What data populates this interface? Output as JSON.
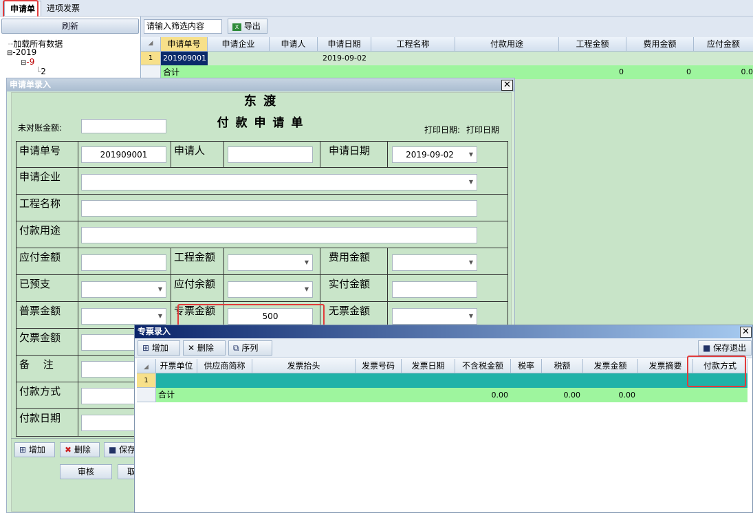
{
  "tabs": {
    "t1": "申请单",
    "t2": "进项发票"
  },
  "left": {
    "refresh": "刷新",
    "tree_root": "加载所有数据",
    "year": "2019",
    "month": "9",
    "day": "2"
  },
  "toolbar": {
    "filter_placeholder": "请输入筛选内容",
    "export": "导出"
  },
  "main_grid": {
    "headers": [
      "申请单号",
      "申请企业",
      "申请人",
      "申请日期",
      "工程名称",
      "付款用途",
      "工程金额",
      "费用金额",
      "应付金额"
    ],
    "row_num": "1",
    "row": {
      "id": "201909001",
      "date": "2019-09-02"
    },
    "total_label": "合计",
    "totals": {
      "gc": "0",
      "fy": "0",
      "yf": "0.0"
    }
  },
  "form": {
    "title": "申请单录入",
    "company": "东 渡",
    "subtitle": "付 款 申 请 单",
    "unmatched_label": "未对账金额:",
    "print_date_label": "打印日期:",
    "print_date_value": "打印日期",
    "labels": {
      "no": "申请单号",
      "person": "申请人",
      "date": "申请日期",
      "firm": "申请企业",
      "project": "工程名称",
      "purpose": "付款用途",
      "payable": "应付金额",
      "proj_amt": "工程金额",
      "fee_amt": "费用金额",
      "prepaid": "已预支",
      "pay_remain": "应付余额",
      "actual": "实付金额",
      "normal_inv": "普票金额",
      "special_inv": "专票金额",
      "no_inv": "无票金额",
      "owed_inv": "欠票金额",
      "remark": "备　 注",
      "pay_method": "付款方式",
      "pay_date": "付款日期"
    },
    "values": {
      "no": "201909001",
      "date": "2019-09-02",
      "special_inv": "500"
    },
    "buttons": {
      "add": "增加",
      "del": "删除",
      "save": "保存",
      "audit": "审核",
      "cancel": "取"
    }
  },
  "inv": {
    "title": "专票录入",
    "add": "增加",
    "del": "删除",
    "order": "序列",
    "save_exit": "保存退出",
    "headers": [
      "开票单位",
      "供应商简称",
      "发票抬头",
      "发票号码",
      "发票日期",
      "不含税金额",
      "税率",
      "税额",
      "发票金额",
      "发票摘要",
      "付款方式"
    ],
    "row_num": "1",
    "total_label": "合计",
    "totals": {
      "ex": "0.00",
      "tax": "0.00",
      "amt": "0.00"
    }
  }
}
